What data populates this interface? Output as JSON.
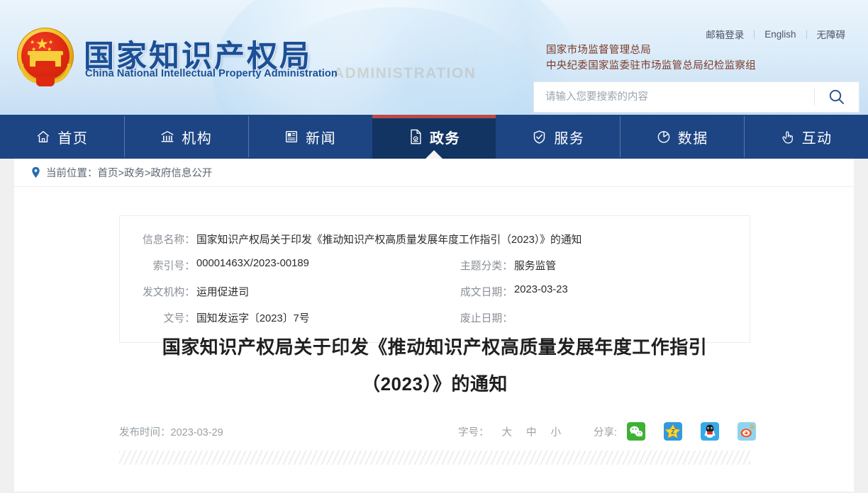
{
  "header": {
    "logo_cn": "国家知识产权局",
    "logo_en": "China National Intellectual Property Administration",
    "watermark": "ADMINISTRATION",
    "emblem_name": "national-emblem",
    "top_links": [
      {
        "label": "邮箱登录"
      },
      {
        "label": "English"
      },
      {
        "label": "无障碍"
      }
    ],
    "org_lines": [
      "国家市场监督管理总局",
      "中央纪委国家监委驻市场监管总局纪检监察组"
    ],
    "search": {
      "placeholder": "请输入您要搜索的内容",
      "value": "",
      "button_icon": "search-icon"
    }
  },
  "nav": {
    "items": [
      {
        "label": "首页",
        "icon": "home-icon",
        "active": false
      },
      {
        "label": "机构",
        "icon": "bank-icon",
        "active": false
      },
      {
        "label": "新闻",
        "icon": "newspaper-icon",
        "active": false
      },
      {
        "label": "政务",
        "icon": "document-seal-icon",
        "active": true
      },
      {
        "label": "服务",
        "icon": "shield-check-icon",
        "active": false
      },
      {
        "label": "数据",
        "icon": "pie-chart-icon",
        "active": false
      },
      {
        "label": "互动",
        "icon": "hand-click-icon",
        "active": false
      }
    ]
  },
  "breadcrumb": {
    "icon": "location-pin-icon",
    "prefix": "当前位置：",
    "path": "首页>政务>政府信息公开",
    "full": "当前位置：首页>政务>政府信息公开"
  },
  "info_table": {
    "rows": [
      [
        {
          "key": "信息名称：",
          "value": "国家知识产权局关于印发《推动知识产权高质量发展年度工作指引（2023）》的通知",
          "span": 2
        }
      ],
      [
        {
          "key": "索引号：",
          "value": "00001463X/2023-00189"
        },
        {
          "key": "主题分类：",
          "value": "服务监管"
        }
      ],
      [
        {
          "key": "发文机构：",
          "value": "运用促进司"
        },
        {
          "key": "成文日期：",
          "value": "2023-03-23"
        }
      ],
      [
        {
          "key": "文号：",
          "value": "国知发运字〔2023〕7号"
        },
        {
          "key": "废止日期：",
          "value": ""
        }
      ]
    ]
  },
  "article": {
    "title_line1": "国家知识产权局关于印发《推动知识产权高质量发展年度工作指引",
    "title_line2": "（2023）》的通知",
    "publish_label": "发布时间：2023-03-29",
    "fontsize_label": "字号：",
    "fontsize_options": [
      "大",
      "中",
      "小"
    ],
    "share_label": "分享:",
    "share_icons": [
      {
        "name": "wechat-share-icon",
        "color": "#3eb135"
      },
      {
        "name": "qzone-share-icon",
        "color": "#2f9ae0"
      },
      {
        "name": "qq-share-icon",
        "color": "#37a9e8"
      },
      {
        "name": "weibo-share-icon",
        "color": "#8fd3f0"
      }
    ]
  },
  "colors": {
    "nav_bg": "#1d4584",
    "nav_active_bg": "#123463",
    "nav_active_top": "#b84b46",
    "logo_blue": "#1b4f96",
    "org_brown": "#7c3a28",
    "page_bg": "#f0f0f0"
  }
}
